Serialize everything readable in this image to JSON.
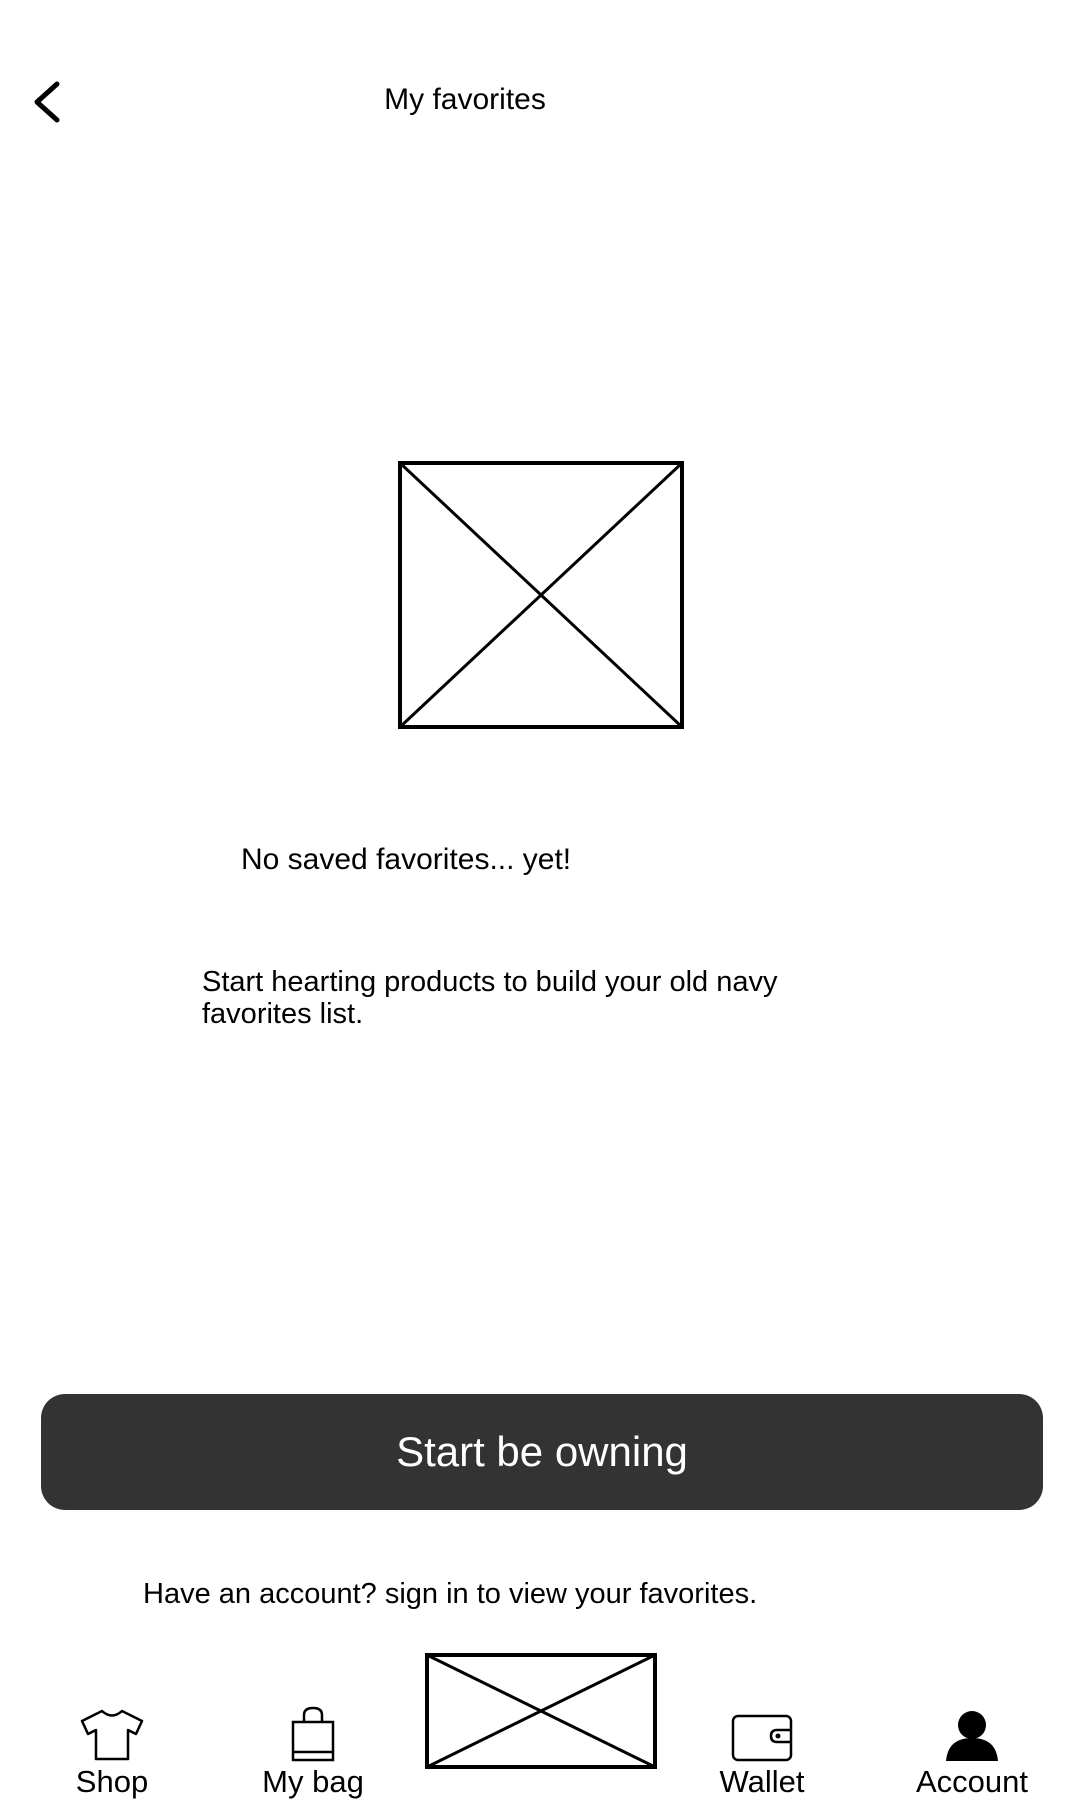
{
  "header": {
    "title": "My favorites",
    "back_icon": "chevron-left-icon"
  },
  "empty_state": {
    "image_icon": "image-placeholder-icon",
    "title": "No saved favorites... yet!",
    "description": "Start hearting products to build your old navy favorites list."
  },
  "cta": {
    "label": "Start be owning",
    "color": "#333333"
  },
  "signin_prompt": "Have an account? sign in to view your favorites.",
  "bottom_nav": {
    "items": [
      {
        "label": "Shop",
        "icon": "tshirt-icon"
      },
      {
        "label": "My bag",
        "icon": "shopping-bag-icon"
      },
      {
        "label": "",
        "icon": "image-placeholder-icon"
      },
      {
        "label": "Wallet",
        "icon": "wallet-icon"
      },
      {
        "label": "Account",
        "icon": "person-icon"
      }
    ]
  }
}
